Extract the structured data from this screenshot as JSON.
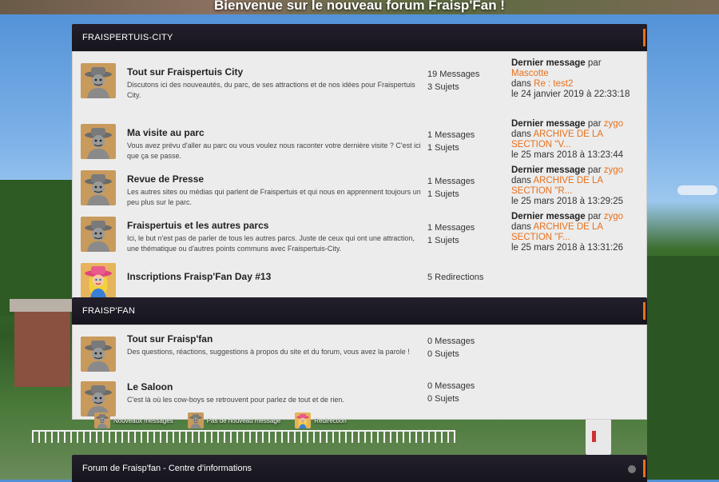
{
  "site": {
    "title": "Bienvenue sur le nouveau forum Fraisp'Fan !"
  },
  "categories": [
    {
      "title": "FRAISPERTUIS-CITY",
      "forums": [
        {
          "name": "Tout sur Fraispertuis City",
          "description": "Discutons ici des nouveautés, du parc, de ses attractions et de nos idées pour Fraispertuis City.",
          "messages": "19 Messages",
          "topics": "3 Sujets",
          "last_label": "Dernier message",
          "by": "par",
          "author": "Mascotte",
          "in": "dans",
          "topic": "Re : test2",
          "date": "le 24 janvier 2019 à 22:33:18",
          "avatar": "cowboy-icon"
        },
        {
          "name": "Ma visite au parc",
          "description": "Vous avez prévu d'aller au parc ou vous voulez nous raconter votre dernière visite ? C'est ici que ça se passe.",
          "messages": "1 Messages",
          "topics": "1 Sujets",
          "last_label": "Dernier message",
          "by": "par",
          "author": "zygo",
          "in": "dans",
          "topic": "ARCHIVE DE LA SECTION \"V...",
          "date": "le 25 mars 2018 à 13:23:44",
          "avatar": "cowboy-icon"
        },
        {
          "name": "Revue de Presse",
          "description": "Les autres sites ou médias qui parlent de Fraispertuis et qui nous en apprennent toujours un peu plus sur le parc.",
          "messages": "1 Messages",
          "topics": "1 Sujets",
          "last_label": "Dernier message",
          "by": "par",
          "author": "zygo",
          "in": "dans",
          "topic": "ARCHIVE DE LA SECTION \"R...",
          "date": "le 25 mars 2018 à 13:29:25",
          "avatar": "cowboy-icon"
        },
        {
          "name": "Fraispertuis et les autres parcs",
          "description": "Ici, le but n'est pas de parler de tous les autres parcs. Juste de ceux qui ont une attraction, une thématique ou d'autres points communs avec Fraispertuis-City.",
          "messages": "1 Messages",
          "topics": "1 Sujets",
          "last_label": "Dernier message",
          "by": "par",
          "author": "zygo",
          "in": "dans",
          "topic": "ARCHIVE DE LA SECTION \"F...",
          "date": "le 25 mars 2018 à 13:31:26",
          "avatar": "cowboy-icon"
        },
        {
          "name": "Inscriptions Fraisp'Fan Day #13",
          "redirections": "5 Redirections",
          "avatar": "cowgirl-icon"
        }
      ]
    },
    {
      "title": "FRAISP'FAN",
      "forums": [
        {
          "name": "Tout sur Fraisp'fan",
          "description": "Des questions, réactions, suggestions à propos du site et du forum, vous avez la parole !",
          "messages": "0 Messages",
          "topics": "0 Sujets",
          "avatar": "cowboy-icon"
        },
        {
          "name": "Le Saloon",
          "description": "C'est là où les cow-boys se retrouvent pour parlez de tout et de rien.",
          "messages": "0 Messages",
          "topics": "0 Sujets",
          "avatar": "cowboy-icon"
        }
      ]
    }
  ],
  "legend": {
    "new_messages": "Nouveaux messages",
    "no_new_message": "Pas de nouveau message",
    "redirection": "Redirection"
  },
  "footer": {
    "title": "Forum de Fraisp'fan - Centre d'informations"
  },
  "colors": {
    "accent": "#e8701a",
    "header_bg": "#1c1a24",
    "panel_bg": "#ececec"
  }
}
